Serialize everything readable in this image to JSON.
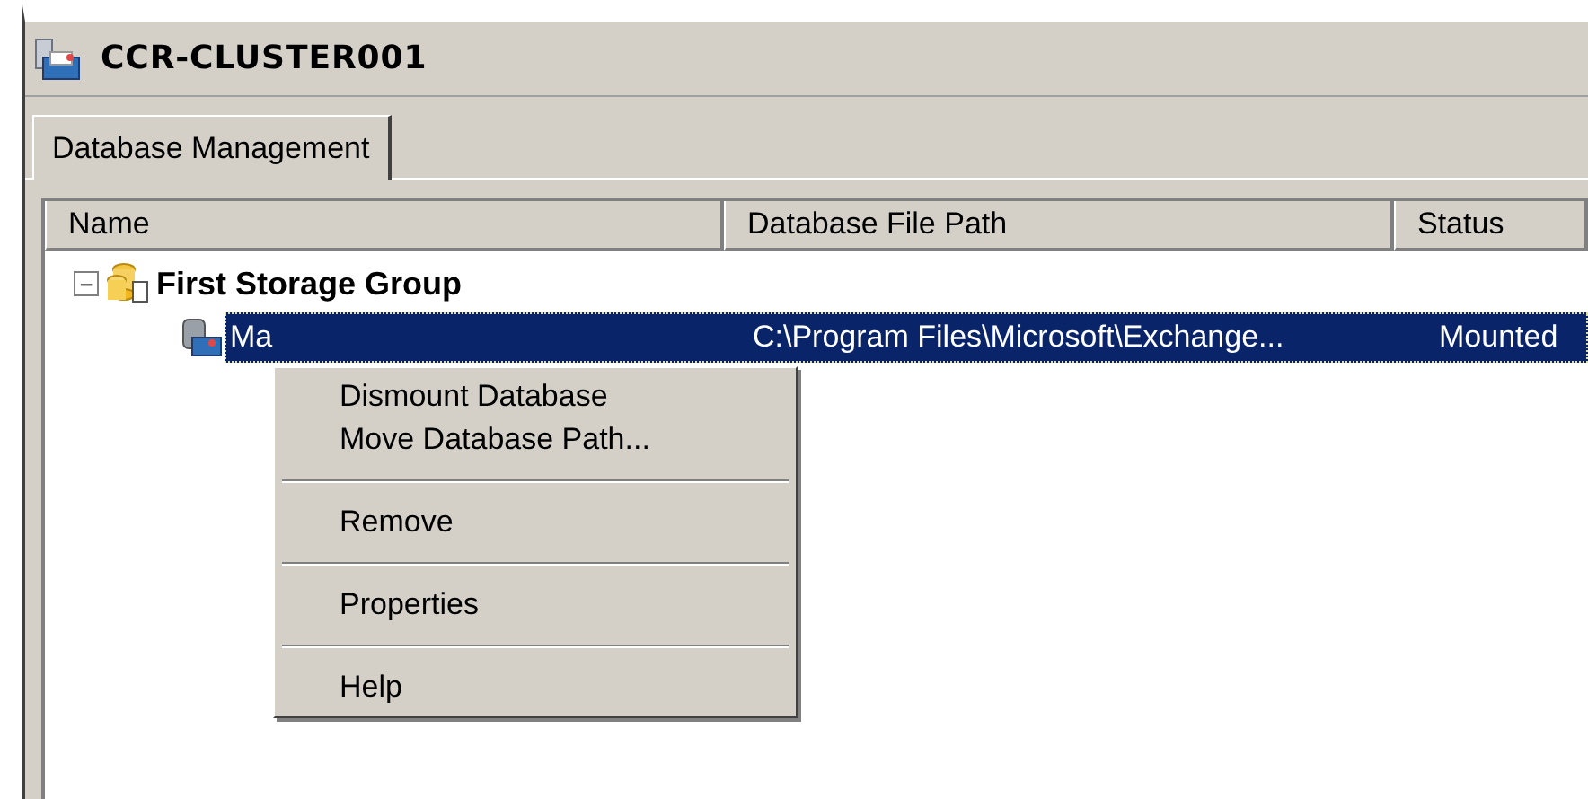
{
  "window": {
    "title": "CCR-CLUSTER001"
  },
  "tabs": [
    {
      "label": "Database Management",
      "selected": true
    }
  ],
  "table": {
    "columns": [
      "Name",
      "Database File Path",
      "Status"
    ],
    "groups": [
      {
        "name": "First Storage Group",
        "expanded": true,
        "expander": "−",
        "rows": [
          {
            "name": "Ma",
            "path": "C:\\Program Files\\Microsoft\\Exchange...",
            "status": "Mounted",
            "selected": true
          }
        ]
      }
    ]
  },
  "context_menu": {
    "items": [
      {
        "kind": "item",
        "label": "Dismount Database"
      },
      {
        "kind": "item",
        "label": "Move Database Path..."
      },
      {
        "kind": "separator"
      },
      {
        "kind": "item",
        "label": "Remove"
      },
      {
        "kind": "separator"
      },
      {
        "kind": "item",
        "label": "Properties"
      },
      {
        "kind": "separator"
      },
      {
        "kind": "item",
        "label": "Help"
      }
    ]
  }
}
